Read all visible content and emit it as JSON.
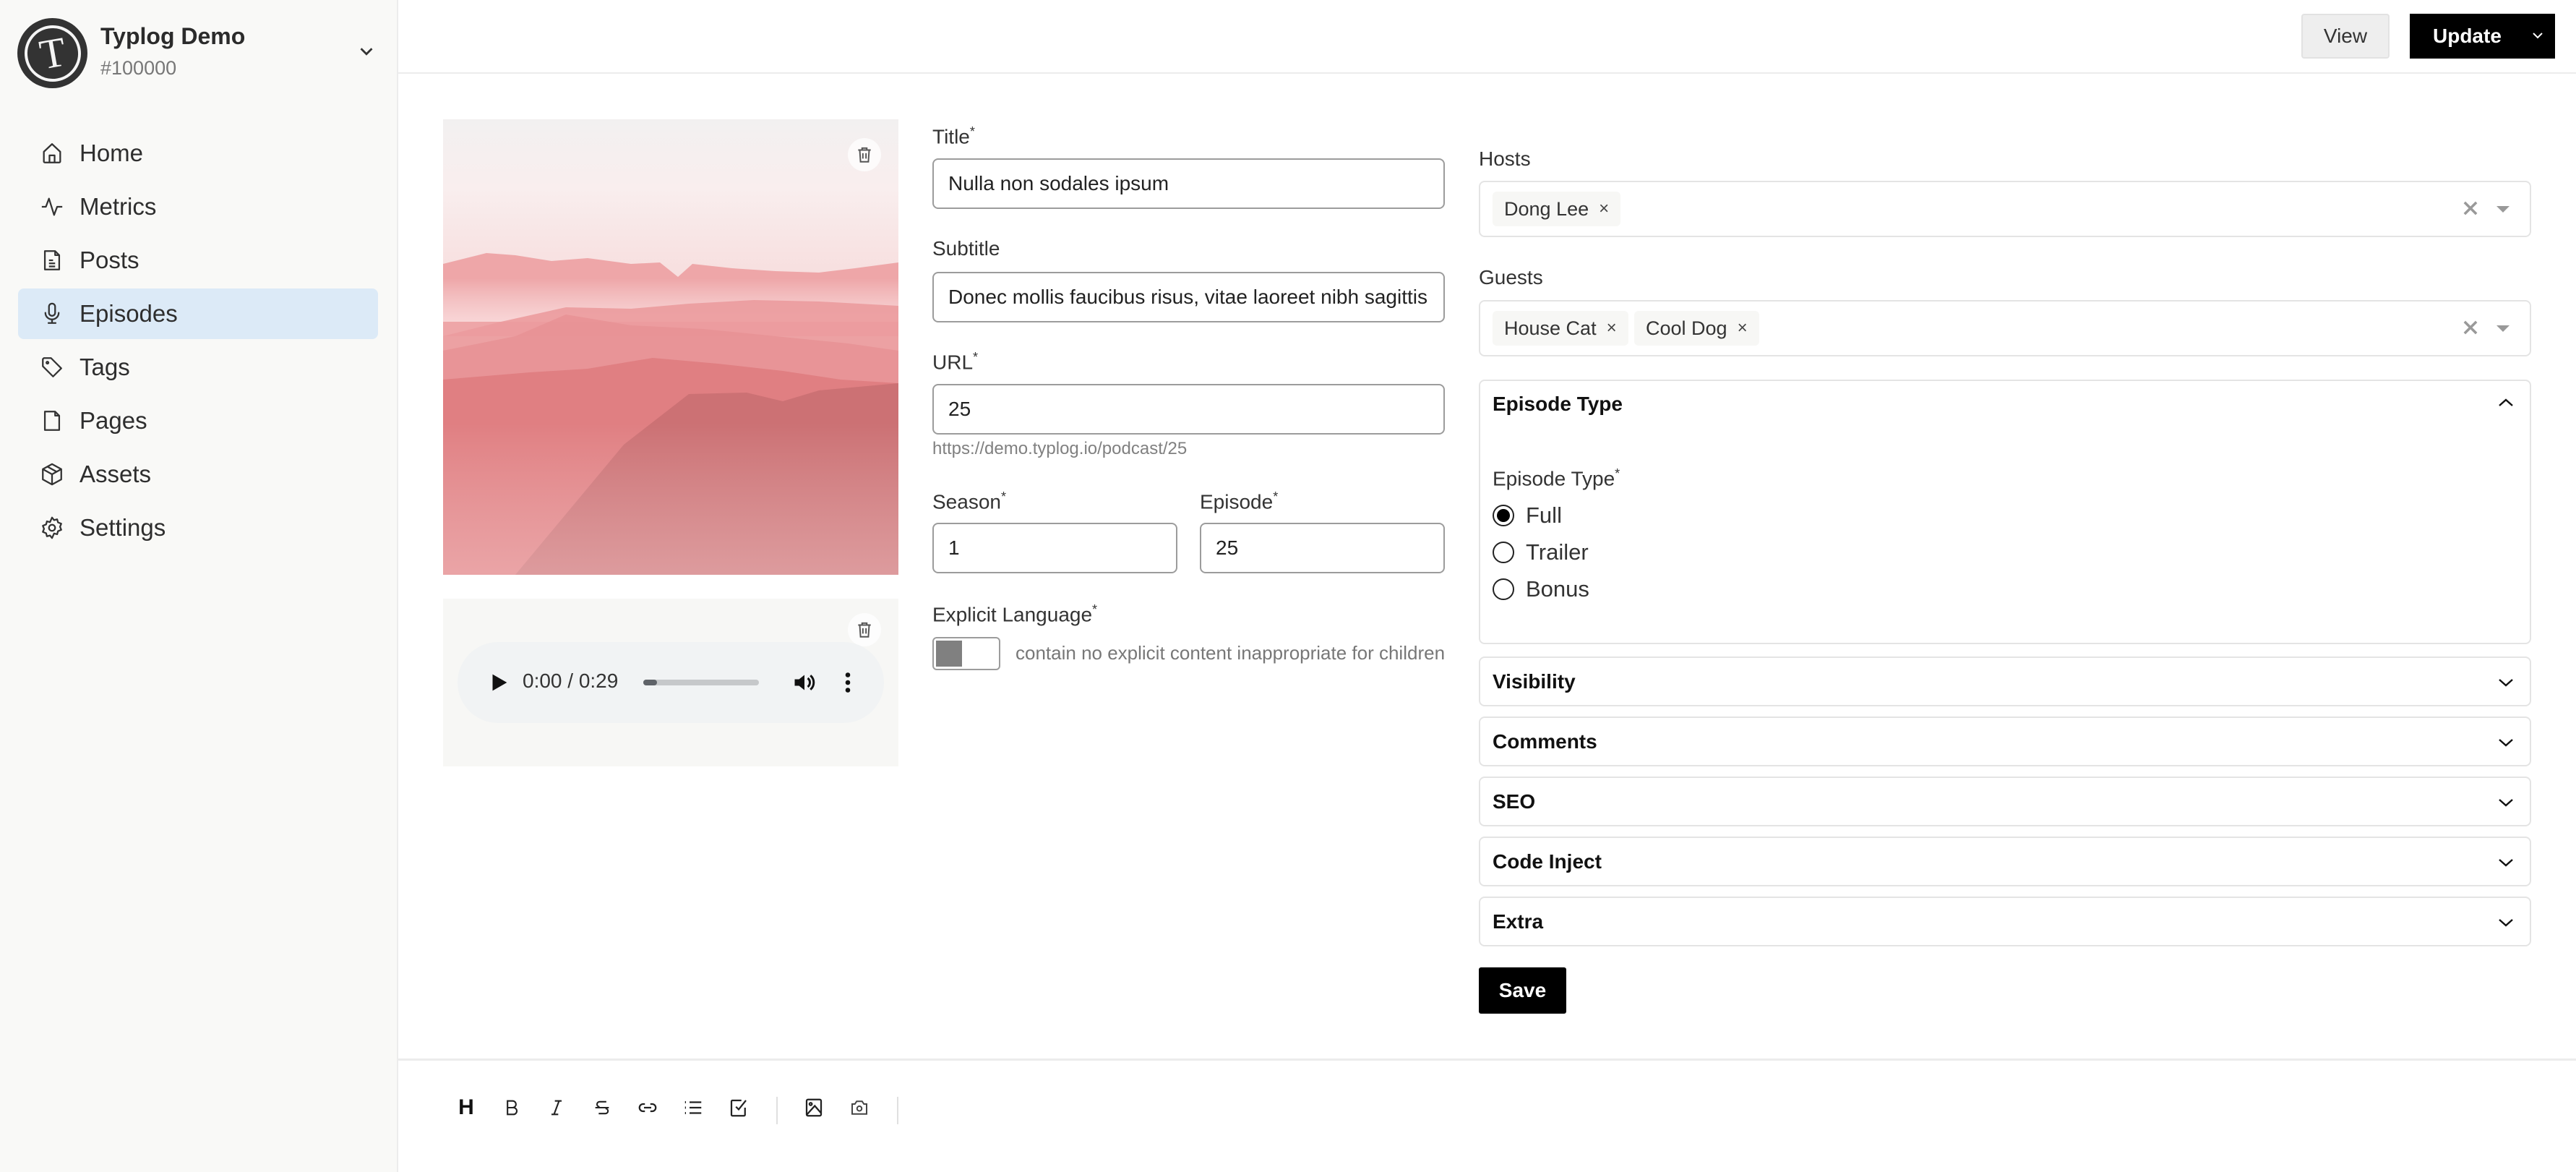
{
  "site": {
    "name": "Typlog Demo",
    "id": "#100000",
    "logo_letter": "T"
  },
  "sidebar": {
    "items": [
      {
        "label": "Home",
        "icon": "home-icon",
        "active": false
      },
      {
        "label": "Metrics",
        "icon": "activity-icon",
        "active": false
      },
      {
        "label": "Posts",
        "icon": "document-icon",
        "active": false
      },
      {
        "label": "Episodes",
        "icon": "microphone-icon",
        "active": true
      },
      {
        "label": "Tags",
        "icon": "tag-icon",
        "active": false
      },
      {
        "label": "Pages",
        "icon": "page-icon",
        "active": false
      },
      {
        "label": "Assets",
        "icon": "box-icon",
        "active": false
      },
      {
        "label": "Settings",
        "icon": "gear-icon",
        "active": false
      }
    ]
  },
  "header": {
    "view_label": "View",
    "update_label": "Update"
  },
  "media": {
    "audio": {
      "time_display": "0:00 / 0:29",
      "progress_fraction": 0.04
    }
  },
  "form": {
    "title": {
      "label": "Title",
      "required": "*",
      "value": "Nulla non sodales ipsum"
    },
    "subtitle": {
      "label": "Subtitle",
      "value": "Donec mollis faucibus risus, vitae laoreet nibh sagittis s"
    },
    "url": {
      "label": "URL",
      "required": "*",
      "value": "25",
      "hint": "https://demo.typlog.io/podcast/25"
    },
    "season": {
      "label": "Season",
      "required": "*",
      "value": "1"
    },
    "episode": {
      "label": "Episode",
      "required": "*",
      "value": "25"
    },
    "explicit": {
      "label": "Explicit Language",
      "required": "*",
      "checked": false,
      "description": "contain no explicit content inappropriate for children"
    }
  },
  "people": {
    "hosts": {
      "label": "Hosts",
      "values": [
        "Dong Lee"
      ]
    },
    "guests": {
      "label": "Guests",
      "values": [
        "House Cat",
        "Cool Dog"
      ]
    },
    "remove_glyph": "×"
  },
  "panels": {
    "episode_type": {
      "title": "Episode Type",
      "expanded": true,
      "field_label": "Episode Type",
      "required": "*",
      "options": [
        "Full",
        "Trailer",
        "Bonus"
      ],
      "selected": "Full"
    },
    "collapsed": [
      "Visibility",
      "Comments",
      "SEO",
      "Code Inject",
      "Extra"
    ]
  },
  "save_label": "Save",
  "editor_toolbar": {
    "buttons": [
      "heading",
      "bold",
      "italic",
      "strikethrough",
      "link",
      "bullet-list",
      "task-list",
      "image",
      "camera"
    ],
    "heading_glyph": "H"
  },
  "colors": {
    "sidebar_bg": "#f9f9f7",
    "active_nav_bg": "#dceaf7",
    "primary_button": "#000000"
  }
}
